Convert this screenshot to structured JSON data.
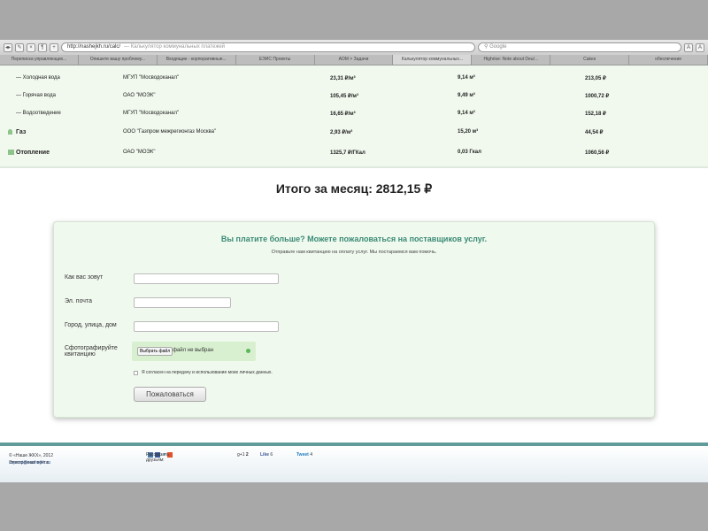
{
  "browser": {
    "url": "http://nashejkh.ru/calc/",
    "page_title": "— Калькулятор коммунальных платежей",
    "search_placeholder": "Google",
    "tabs": [
      "Переписка управляющих...",
      "Опишите вашу проблему...",
      "Входящие - корпоративные...",
      "ЕЭИС Проекты",
      "АОМ > Задачи",
      "Калькулятор коммунальных...",
      "Highrise: Note about Deu/...",
      "Cakes",
      "обеспечение"
    ]
  },
  "rows": [
    {
      "name": "— Холодная вода",
      "provider": "МГУП \"Мосводоканал\"",
      "rate": "23,31 ₽/м³",
      "amount": "9,14 м³",
      "sum": "213,05 ₽"
    },
    {
      "name": "— Горячая вода",
      "provider": "ОАО \"МОЭК\"",
      "rate": "105,45 ₽/м³",
      "amount": "9,49 м³",
      "sum": "1000,72 ₽"
    },
    {
      "name": "— Водоотведение",
      "provider": "МГУП \"Мосводоканал\"",
      "rate": "16,65 ₽/м³",
      "amount": "9,14 м³",
      "sum": "152,18 ₽"
    },
    {
      "name": "Газ",
      "provider": "ООО \"Газпром межрегионгаз Москва\"",
      "rate": "2,93 ₽/м³",
      "amount": "15,20 м³",
      "sum": "44,54 ₽"
    },
    {
      "name": "Отопление",
      "provider": "ОАО \"МОЭК\"",
      "rate": "1325,7 ₽/ГКал",
      "amount": "0,03 Гкал",
      "sum": "1060,56 ₽"
    }
  ],
  "total": "Итого за месяц: 2812,15 ₽",
  "form": {
    "heading": "Вы платите больше? Можете пожаловаться на поставщиков услуг.",
    "subheading": "Отправьте нам квитанцию на оплату услуг. Мы постараемся вам помочь.",
    "name_label": "Как вас зовут",
    "email_label": "Эл. почта",
    "address_label": "Город, улица, дом",
    "photo_label": "Сфотографируйте квитанцию",
    "file_button": "Выбрать файл",
    "file_status": "файл не выбран",
    "consent": "Я согласен на передачу и использование моих личных данных.",
    "submit": "Пожаловаться"
  },
  "footer": {
    "copyright": "© «Наше ЖКХ», 2012",
    "email_label": "Электронная почта:",
    "email": "voprosi@nashejkh.ru",
    "share": "Рассказать друзьям:",
    "gplus_count": "2",
    "like": "Like",
    "like_count": "6",
    "tweet": "Tweet",
    "tweet_count": "4"
  }
}
